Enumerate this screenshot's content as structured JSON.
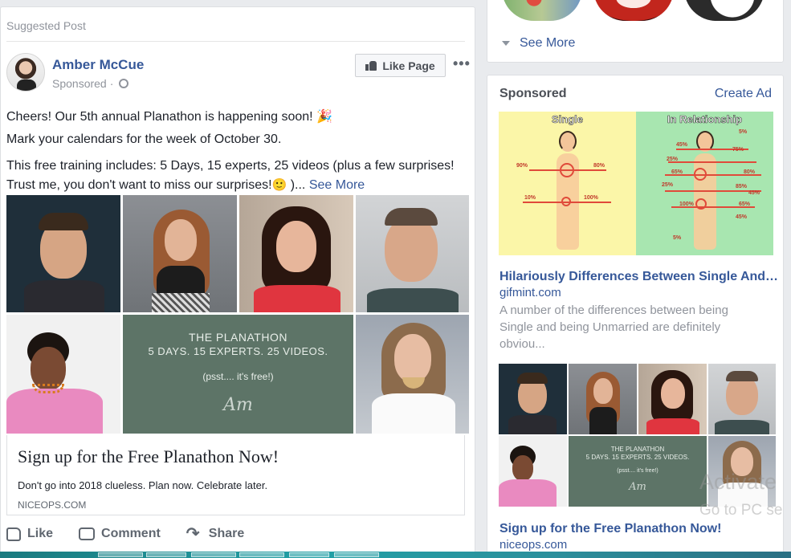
{
  "post": {
    "suggested_label": "Suggested Post",
    "author": "Amber McCue",
    "sponsored": "Sponsored",
    "like_page": "Like Page",
    "more": "•••",
    "text_line1": "Cheers! Our 5th annual Planathon is happening soon! 🎉",
    "text_line2": "Mark your calendars for the week of October 30.",
    "text_line3_part1": "This free training includes: 5 Days, 15 experts, 25 videos (plus a few surprises! Trust me, you don't want to miss our surprises!",
    "text_line3_emoji": "🙂",
    "text_line3_part2": " )... ",
    "see_more": "See More",
    "ad_image": {
      "heading": "THE PLANATHON",
      "subheading": "5 DAYS. 15 EXPERTS. 25 VIDEOS.",
      "note": "(psst.... it's free!)",
      "signature": "Am"
    },
    "ad_headline": "Sign up for the Free Planathon Now!",
    "ad_description": "Don't go into 2018 clueless. Plan now. Celebrate later.",
    "ad_domain": "NICEOPS.COM",
    "actions": {
      "like": "Like",
      "comment": "Comment",
      "share": "Share"
    }
  },
  "sidebar": {
    "see_more": "See More",
    "sponsored_header": "Sponsored",
    "create_ad": "Create Ad",
    "ad1": {
      "image_left_title": "Single",
      "image_right_title": "In Relationship",
      "single_pcts": [
        "90%",
        "80%",
        "10%",
        "100%"
      ],
      "relationship_pcts": [
        "5%",
        "45%",
        "75%",
        "25%",
        "65%",
        "80%",
        "25%",
        "85%",
        "45%",
        "100%",
        "65%",
        "45%",
        "5%"
      ],
      "title": "Hilariously Differences Between Single And…",
      "domain": "gifmint.com",
      "body": "A number of the differences between being Single and being Unmarried are definitely obviou..."
    },
    "ad2": {
      "image_heading": "THE PLANATHON",
      "image_subheading": "5 DAYS. 15 EXPERTS. 25 VIDEOS.",
      "image_note": "(psst.... it's free!)",
      "title": "Sign up for the Free Planathon Now!",
      "domain": "niceops.com"
    }
  },
  "watermark": {
    "line1": "Activate",
    "line2": "Go to PC se"
  },
  "colors": {
    "link": "#365899",
    "muted": "#90949c",
    "panel": "#5d7467",
    "background": "#e9ebee"
  }
}
